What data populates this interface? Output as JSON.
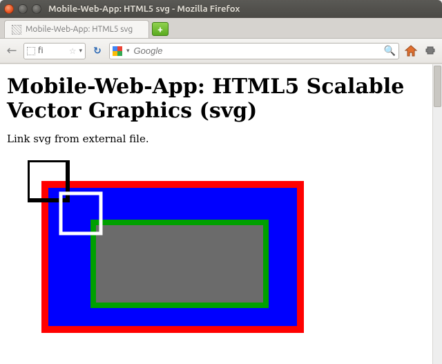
{
  "window": {
    "title": "Mobile-Web-App: HTML5 svg - Mozilla Firefox"
  },
  "tab": {
    "label": "Mobile-Web-App: HTML5 svg"
  },
  "newtab_glyph": "+",
  "navbar": {
    "back_glyph": "←",
    "url_text": "fi",
    "star_glyph": "☆",
    "dropdown_glyph": "▾",
    "reload_glyph": "↻",
    "search_dropdown_glyph": "▾",
    "search_placeholder": "Google",
    "magnifier_glyph": "🔍"
  },
  "page": {
    "heading": "Mobile-Web-App: HTML5 Scalable Vector Graphics (svg)",
    "paragraph": "Link svg from external file."
  },
  "svg": {
    "outer_fill": "#ff0000",
    "mid_fill": "#0000ff",
    "inner_stroke": "#009900",
    "inner_fill": "#6b6b6b",
    "small_black_stroke": "#000000",
    "small_white_stroke": "#ffffff"
  }
}
